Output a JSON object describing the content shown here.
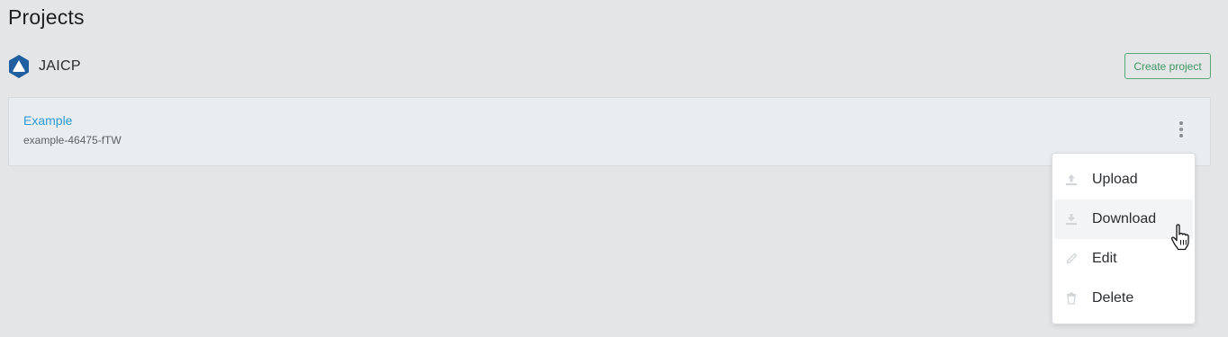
{
  "page": {
    "title": "Projects"
  },
  "workspace": {
    "name": "JAICP",
    "logo_icon": "jaicp-logo-icon",
    "logo_color": "#1f5fa0"
  },
  "toolbar": {
    "create_label": "Create project",
    "create_color": "#3f9763"
  },
  "project": {
    "name": "Example",
    "id": "example-46475-fTW",
    "name_color": "#2c9ad6",
    "menu_icon": "more-vertical-icon"
  },
  "context_menu": {
    "items": [
      {
        "label": "Upload",
        "icon": "upload-icon"
      },
      {
        "label": "Download",
        "icon": "download-icon",
        "hovered": true
      },
      {
        "label": "Edit",
        "icon": "pencil-icon"
      },
      {
        "label": "Delete",
        "icon": "trash-icon"
      }
    ]
  },
  "pointer": {
    "icon": "hand-pointer-cursor-icon"
  }
}
